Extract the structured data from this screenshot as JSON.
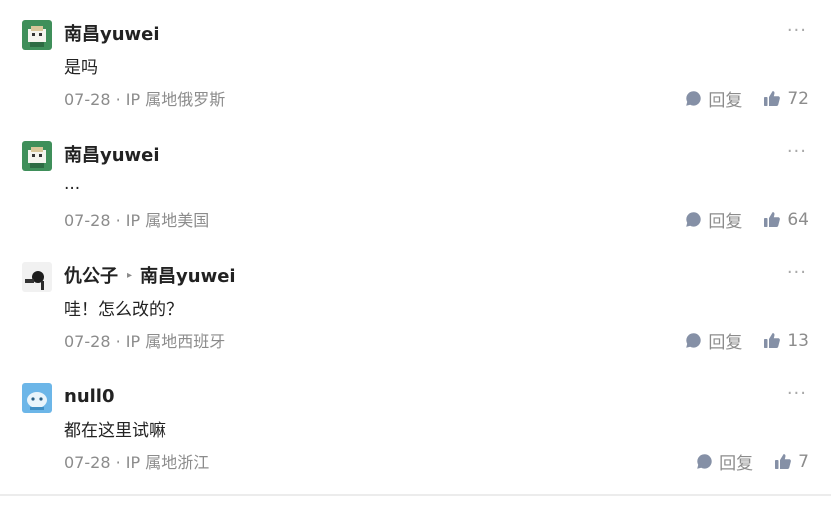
{
  "comments": [
    {
      "author": "南昌yuwei",
      "reply_to": "",
      "text": "是吗",
      "meta": "07-28 · IP 属地俄罗斯",
      "reply_label": "回复",
      "likes": "72",
      "more": "···",
      "avatar_icon": "green-character-avatar"
    },
    {
      "author": "南昌yuwei",
      "reply_to": "",
      "text": "...",
      "meta": "07-28 · IP 属地美国",
      "reply_label": "回复",
      "likes": "64",
      "more": "···",
      "avatar_icon": "green-character-avatar"
    },
    {
      "author": "仇公子",
      "reply_to": "南昌yuwei",
      "text": "哇！怎么改的？",
      "meta": "07-28 · IP 属地西班牙",
      "reply_label": "回复",
      "likes": "13",
      "more": "···",
      "avatar_icon": "dark-photo-avatar"
    },
    {
      "author": "null0",
      "reply_to": "",
      "text": "都在这里试嘛",
      "meta": "07-28 · IP 属地浙江",
      "reply_label": "回复",
      "likes": "7",
      "more": "···",
      "avatar_icon": "blue-cartoon-avatar"
    }
  ],
  "colors": {
    "text_primary": "#222222",
    "text_secondary": "#8c8c8c",
    "icon_gray": "#8590a6",
    "divider": "#ececec"
  }
}
